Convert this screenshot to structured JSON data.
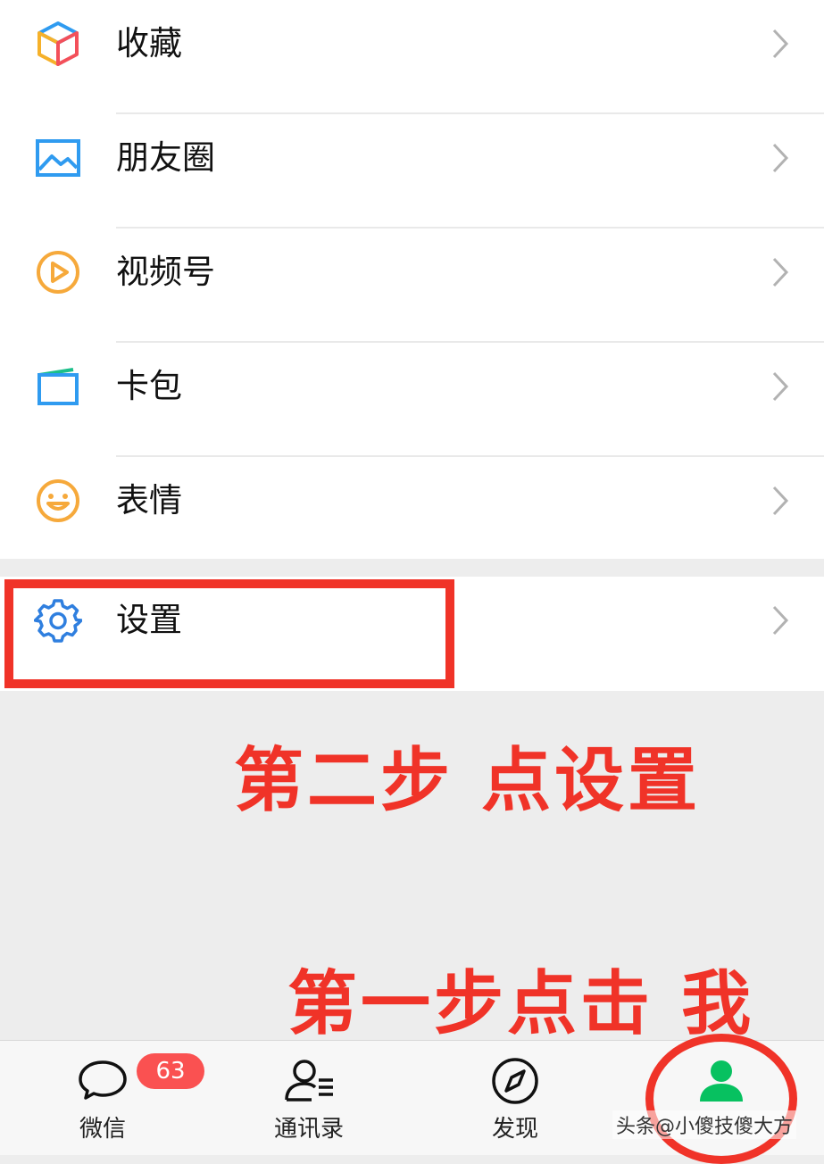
{
  "menu": {
    "items": [
      {
        "label": "收藏",
        "icon": "favorites-cube-icon"
      },
      {
        "label": "朋友圈",
        "icon": "moments-image-icon"
      },
      {
        "label": "视频号",
        "icon": "channels-play-icon"
      },
      {
        "label": "卡包",
        "icon": "card-wallet-icon"
      },
      {
        "label": "表情",
        "icon": "sticker-smile-icon"
      }
    ],
    "settings": {
      "label": "设置",
      "icon": "gear-icon"
    }
  },
  "annotations": {
    "step_two": "第二步 点设置",
    "step_one": "第一步点击 我"
  },
  "tabbar": {
    "chats": {
      "label": "微信",
      "badge": "63"
    },
    "contacts": {
      "label": "通讯录"
    },
    "discover": {
      "label": "发现"
    },
    "me": {
      "label": ""
    }
  },
  "watermark": "头条@小傻技傻大方",
  "colors": {
    "accent_green": "#07c160",
    "annotation_red": "#f03328",
    "badge_red": "#fa5151"
  }
}
